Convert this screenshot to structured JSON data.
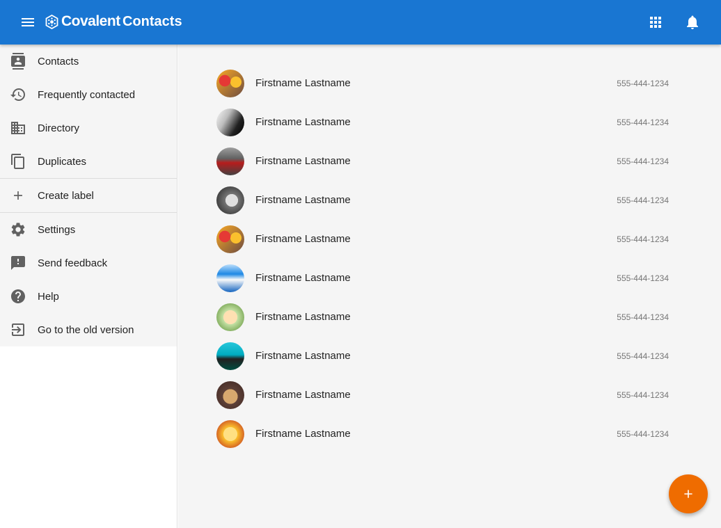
{
  "header": {
    "brand": "Covalent",
    "title": "Contacts",
    "menu_icon": "menu-icon",
    "logo_icon": "covalent-logo-icon",
    "apps_icon": "apps-grid-icon",
    "notifications_icon": "bell-icon"
  },
  "colors": {
    "toolbar": "#1976d2",
    "fab": "#ef6c00",
    "background": "#f5f5f5"
  },
  "sidebar": {
    "items": [
      {
        "label": "Contacts",
        "icon": "contacts-icon"
      },
      {
        "label": "Frequently contacted",
        "icon": "history-icon"
      },
      {
        "label": "Directory",
        "icon": "domain-icon"
      },
      {
        "label": "Duplicates",
        "icon": "copy-icon"
      },
      {
        "label": "Create label",
        "icon": "plus-icon"
      },
      {
        "label": "Settings",
        "icon": "gear-icon"
      },
      {
        "label": "Send feedback",
        "icon": "feedback-icon"
      },
      {
        "label": "Help",
        "icon": "help-icon"
      },
      {
        "label": "Go to the old version",
        "icon": "exit-to-app-icon"
      }
    ]
  },
  "contacts": [
    {
      "name": "Firstname Lastname",
      "phone": "555-444-1234",
      "avatar": "avatar-photo-1"
    },
    {
      "name": "Firstname Lastname",
      "phone": "555-444-1234",
      "avatar": "avatar-photo-2"
    },
    {
      "name": "Firstname Lastname",
      "phone": "555-444-1234",
      "avatar": "avatar-photo-3"
    },
    {
      "name": "Firstname Lastname",
      "phone": "555-444-1234",
      "avatar": "avatar-photo-4"
    },
    {
      "name": "Firstname Lastname",
      "phone": "555-444-1234",
      "avatar": "avatar-photo-5"
    },
    {
      "name": "Firstname Lastname",
      "phone": "555-444-1234",
      "avatar": "avatar-photo-6"
    },
    {
      "name": "Firstname Lastname",
      "phone": "555-444-1234",
      "avatar": "avatar-photo-7"
    },
    {
      "name": "Firstname Lastname",
      "phone": "555-444-1234",
      "avatar": "avatar-photo-8"
    },
    {
      "name": "Firstname Lastname",
      "phone": "555-444-1234",
      "avatar": "avatar-photo-9"
    },
    {
      "name": "Firstname Lastname",
      "phone": "555-444-1234",
      "avatar": "avatar-photo-10"
    }
  ],
  "fab": {
    "icon": "add-icon"
  }
}
